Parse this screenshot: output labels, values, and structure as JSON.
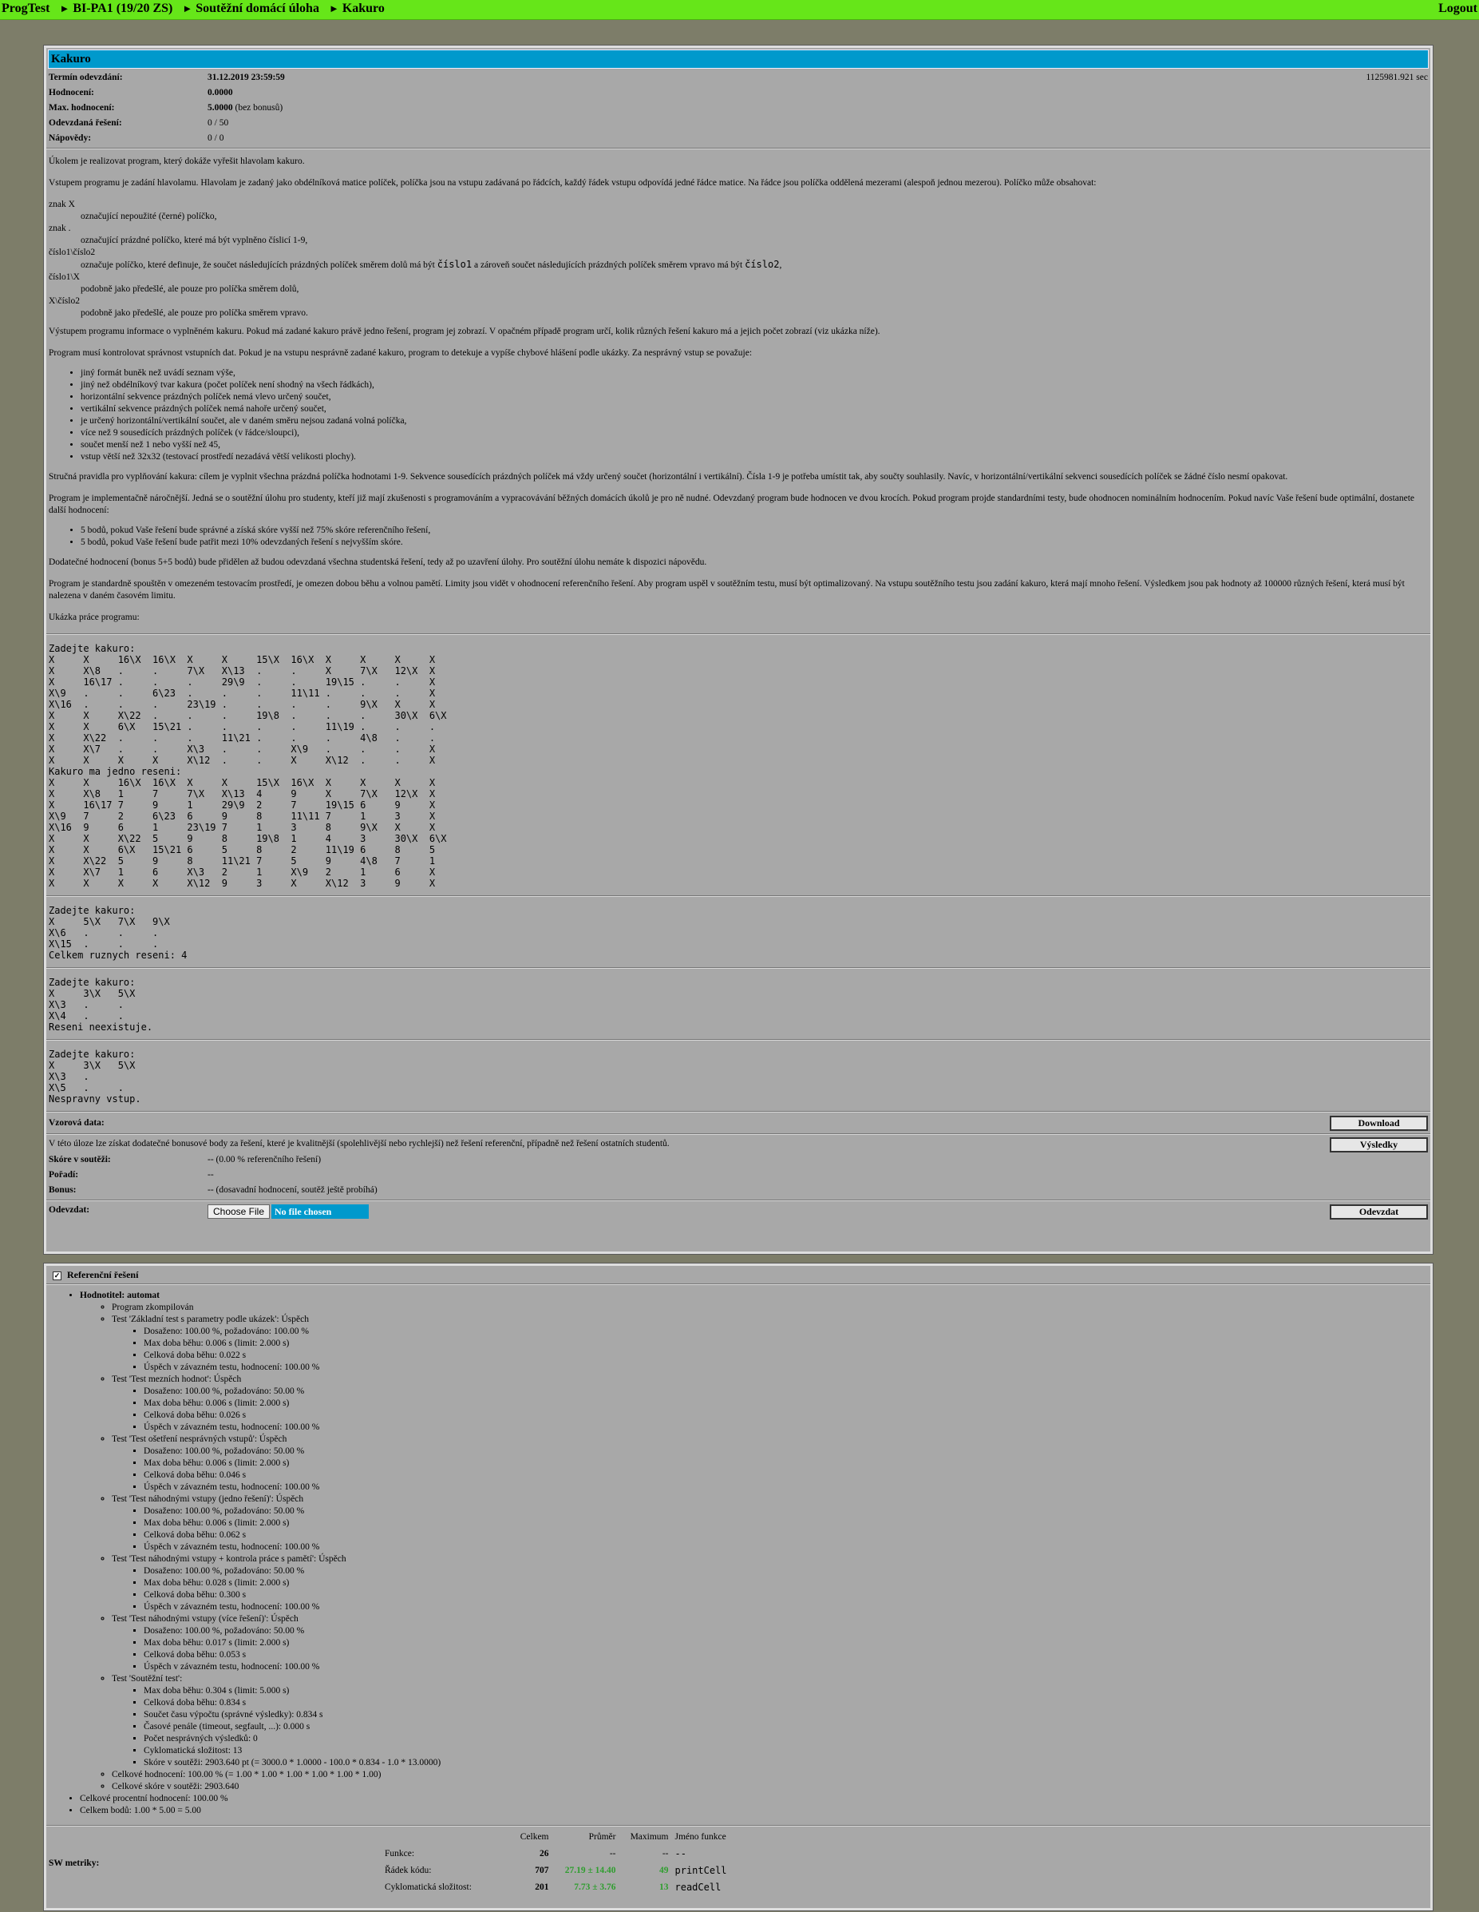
{
  "topbar": {
    "crumbs": [
      "ProgTest",
      "BI-PA1 (19/20 ZS)",
      "Soutěžní domácí úloha",
      "Kakuro"
    ],
    "sep": "►",
    "logout": "Logout"
  },
  "task": {
    "title": "Kakuro",
    "info": [
      {
        "label": "Termín odevzdání:",
        "value": "31.12.2019 23:59:59",
        "bold": true,
        "right": "1125981.921 sec"
      },
      {
        "label": "Hodnocení:",
        "value": "0.0000",
        "bold": true
      },
      {
        "label": "Max. hodnocení:",
        "value": "5.0000",
        "extra": " (bez bonusů)",
        "bold": true
      },
      {
        "label": "Odevzdaná řešení:",
        "value": "0 / 50"
      },
      {
        "label": "Nápovědy:",
        "value": "0 / 0"
      }
    ],
    "desc": {
      "p1": "Úkolem je realizovat program, který dokáže vyřešit hlavolam kakuro.",
      "p2": "Vstupem programu je zadání hlavolamu. Hlavolam je zadaný jako obdélníková matice políček, políčka jsou na vstupu zadávaná po řádcích, každý řádek vstupu odpovídá jedné řádce matice. Na řádce jsou políčka oddělená mezerami (alespoň jednou mezerou). Políčko může obsahovat:",
      "defs": [
        {
          "t": "znak X",
          "d": "označující nepoužité (černé) políčko,"
        },
        {
          "t": "znak .",
          "d": "označující prázdné políčko, které má být vyplněno číslicí 1-9,"
        },
        {
          "t": "číslo1\\číslo2",
          "d1": "označuje políčko, které definuje, že součet následujících prázdných políček směrem dolů má být ",
          "m1": "číslo1",
          "d2": " a zároveň součet následujících prázdných políček směrem vpravo má být ",
          "m2": "číslo2",
          "d3": ","
        },
        {
          "t": "číslo1\\X",
          "d": "podobně jako předešlé, ale pouze pro políčka směrem dolů,"
        },
        {
          "t": "X\\číslo2",
          "d": "podobně jako předešlé, ale pouze pro políčka směrem vpravo."
        }
      ],
      "p3": "Výstupem programu informace o vyplněném kakuru. Pokud má zadané kakuro právě jedno řešení, program jej zobrazí. V opačném případě program určí, kolik různých řešení kakuro má a jejich počet zobrazí (viz ukázka níže).",
      "p4": "Program musí kontrolovat správnost vstupních dat. Pokud je na vstupu nesprávně zadané kakuro, program to detekuje a vypíše chybové hlášení podle ukázky. Za nesprávný vstup se považuje:",
      "errors": [
        "jiný formát buněk než uvádí seznam výše,",
        "jiný než obdélníkový tvar kakura (počet políček není shodný na všech řádkách),",
        "horizontální sekvence prázdných políček nemá vlevo určený součet,",
        "vertikální sekvence prázdných políček nemá nahoře určený součet,",
        "je určený horizontální/vertikální součet, ale v daném směru nejsou zadaná volná políčka,",
        "více než 9 sousedících prázdných políček (v řádce/sloupci),",
        "součet menší než 1 nebo vyšší než 45,",
        "vstup větší než 32x32 (testovací prostředí nezadává větší velikosti plochy)."
      ],
      "p5": "Stručná pravidla pro vyplňování kakura: cílem je vyplnit všechna prázdná políčka hodnotami 1-9. Sekvence sousedících prázdných políček má vždy určený součet (horizontální i vertikální). Čísla 1-9 je potřeba umístit tak, aby součty souhlasily. Navíc, v horizontální/vertikální sekvenci sousedících políček se žádné číslo nesmí opakovat.",
      "p6": "Program je implementačně náročnější. Jedná se o soutěžní úlohu pro studenty, kteří již mají zkušenosti s programováním a vypracovávání běžných domácích úkolů je pro ně nudné. Odevzdaný program bude hodnocen ve dvou krocích. Pokud program projde standardními testy, bude ohodnocen nominálním hodnocením. Pokud navíc Vaše řešení bude optimální, dostanete další hodnocení:",
      "bonus": [
        "5 bodů, pokud Vaše řešení bude správné a získá skóre vyšší než 75% skóre referenčního řešení,",
        "5 bodů, pokud Vaše řešení bude patřit mezi 10% odevzdaných řešení s nejvyšším skóre."
      ],
      "p7": "Dodatečné hodnocení (bonus 5+5 bodů) bude přidělen až budou odevzdaná všechna studentská řešení, tedy až po uzavření úlohy. Pro soutěžní úlohu nemáte k dispozici nápovědu.",
      "p8": "Program je standardně spouštěn v omezeném testovacím prostředí, je omezen dobou běhu a volnou pamětí. Limity jsou vidět v ohodnocení referenčního řešení. Aby program uspěl v soutěžním testu, musí být optimalizovaný. Na vstupu soutěžního testu jsou zadání kakuro, která mají mnoho řešení. Výsledkem jsou pak hodnoty až 100000 různých řešení, která musí být nalezena v daném časovém limitu.",
      "p9": "Ukázka práce programu:"
    },
    "samples": [
      "Zadejte kakuro:\nX     X     16\\X  16\\X  X     X     15\\X  16\\X  X     X     X     X\nX     X\\8   .     .     7\\X   X\\13  .     .     X     7\\X   12\\X  X\nX     16\\17 .     .     .     29\\9  .     .     19\\15 .     .     X\nX\\9   .     .     6\\23  .     .     .     11\\11 .     .     .     X\nX\\16  .     .     .     23\\19 .     .     .     .     9\\X   X     X\nX     X     X\\22  .     .     .     19\\8  .     .     .     30\\X  6\\X\nX     X     6\\X   15\\21 .     .     .     .     11\\19 .     .     .\nX     X\\22  .     .     .     11\\21 .     .     .     4\\8   .     .\nX     X\\7   .     .     X\\3   .     .     X\\9   .     .     .     X\nX     X     X     X     X\\12  .     .     X     X\\12  .     .     X\nKakuro ma jedno reseni:\nX     X     16\\X  16\\X  X     X     15\\X  16\\X  X     X     X     X\nX     X\\8   1     7     7\\X   X\\13  4     9     X     7\\X   12\\X  X\nX     16\\17 7     9     1     29\\9  2     7     19\\15 6     9     X\nX\\9   7     2     6\\23  6     9     8     11\\11 7     1     3     X\nX\\16  9     6     1     23\\19 7     1     3     8     9\\X   X     X\nX     X     X\\22  5     9     8     19\\8  1     4     3     30\\X  6\\X\nX     X     6\\X   15\\21 6     5     8     2     11\\19 6     8     5\nX     X\\22  5     9     8     11\\21 7     5     9     4\\8   7     1\nX     X\\7   1     6     X\\3   2     1     X\\9   2     1     6     X\nX     X     X     X     X\\12  9     3     X     X\\12  3     9     X",
      "Zadejte kakuro:\nX     5\\X   7\\X   9\\X\nX\\6   .     .     .\nX\\15  .     .     .\nCelkem ruznych reseni: 4",
      "Zadejte kakuro:\nX     3\\X   5\\X\nX\\3   .     .\nX\\4   .     .\nReseni neexistuje.",
      "Zadejte kakuro:\nX     3\\X   5\\X\nX\\3   .\nX\\5   .     .\nNespravny vstup."
    ],
    "sample_data_label": "Vzorová data:",
    "download": "Download",
    "contest_note": "V této úloze lze získat dodatečné bonusové body za řešení, které je kvalitnější (spolehlivější nebo rychlejší) než řešení referenční, případně než řešení ostatních studentů.",
    "results_btn": "Výsledky",
    "score_rows": [
      {
        "label": "Skóre v soutěži:",
        "value": "-- (0.00 % referenčního řešení)"
      },
      {
        "label": "Pořadí:",
        "value": "--"
      },
      {
        "label": "Bonus:",
        "value": "-- (dosavadní hodnocení, soutěž ještě probíhá)"
      }
    ],
    "submit_label": "Odevzdat:",
    "choose_file": "Choose File",
    "no_file": "No file chosen",
    "submit_btn": "Odevzdat"
  },
  "reference": {
    "title": "Referenční řešení",
    "evaluator": "Hodnotitel: automat",
    "compiled": "Program zkompilován",
    "tests": [
      {
        "name": "Test 'Základní test s parametry podle ukázek': Úspěch",
        "items": [
          "Dosaženo: 100.00 %, požadováno: 100.00 %",
          "Max doba běhu: 0.006 s (limit: 2.000 s)",
          "Celková doba běhu: 0.022 s",
          "Úspěch v závazném testu, hodnocení: 100.00 %"
        ]
      },
      {
        "name": "Test 'Test mezních hodnot': Úspěch",
        "items": [
          "Dosaženo: 100.00 %, požadováno: 50.00 %",
          "Max doba běhu: 0.006 s (limit: 2.000 s)",
          "Celková doba běhu: 0.026 s",
          "Úspěch v závazném testu, hodnocení: 100.00 %"
        ]
      },
      {
        "name": "Test 'Test ošetření nesprávných vstupů': Úspěch",
        "items": [
          "Dosaženo: 100.00 %, požadováno: 50.00 %",
          "Max doba běhu: 0.006 s (limit: 2.000 s)",
          "Celková doba běhu: 0.046 s",
          "Úspěch v závazném testu, hodnocení: 100.00 %"
        ]
      },
      {
        "name": "Test 'Test náhodnými vstupy (jedno řešení)': Úspěch",
        "items": [
          "Dosaženo: 100.00 %, požadováno: 50.00 %",
          "Max doba běhu: 0.006 s (limit: 2.000 s)",
          "Celková doba běhu: 0.062 s",
          "Úspěch v závazném testu, hodnocení: 100.00 %"
        ]
      },
      {
        "name": "Test 'Test náhodnými vstupy + kontrola práce s pamětí': Úspěch",
        "items": [
          "Dosaženo: 100.00 %, požadováno: 50.00 %",
          "Max doba běhu: 0.028 s (limit: 2.000 s)",
          "Celková doba běhu: 0.300 s",
          "Úspěch v závazném testu, hodnocení: 100.00 %"
        ]
      },
      {
        "name": "Test 'Test náhodnými vstupy (více řešení)': Úspěch",
        "items": [
          "Dosaženo: 100.00 %, požadováno: 50.00 %",
          "Max doba běhu: 0.017 s (limit: 2.000 s)",
          "Celková doba běhu: 0.053 s",
          "Úspěch v závazném testu, hodnocení: 100.00 %"
        ]
      },
      {
        "name": "Test 'Soutěžní test':",
        "items": [
          "Max doba běhu: 0.304 s (limit: 5.000 s)",
          "Celková doba běhu: 0.834 s",
          "Součet času výpočtu (správné výsledky): 0.834 s",
          "Časové penále (timeout, segfault, ...): 0.000 s",
          "Počet nesprávných výsledků: 0",
          "Cyklomatická složitost: 13",
          "Skóre v soutěži: 2903.640 pt (= 3000.0 * 1.0000 - 100.0 * 0.834 - 1.0 * 13.0000)"
        ]
      }
    ],
    "total_eval": "Celkové hodnocení: 100.00 % (= 1.00 * 1.00 * 1.00 * 1.00 * 1.00 * 1.00)",
    "total_score": "Celkové skóre v soutěži: 2903.640",
    "percent": "Celkové procentní hodnocení: 100.00 %",
    "points": "Celkem bodů: 1.00 * 5.00 = 5.00"
  },
  "metrics": {
    "label": "SW metriky:",
    "headers": [
      "",
      "Celkem",
      "Průměr",
      "Maximum",
      "Jméno funkce"
    ],
    "rows": [
      {
        "name": "Funkce:",
        "total": "26",
        "avg": "--",
        "max": "--",
        "fn": "--"
      },
      {
        "name": "Řádek kódu:",
        "total": "707",
        "avg": "27.19 ± 14.40",
        "max": "49",
        "fn": "printCell"
      },
      {
        "name": "Cyklomatická složitost:",
        "total": "201",
        "avg": "7.73 ± 3.76",
        "max": "13",
        "fn": "readCell"
      }
    ]
  }
}
